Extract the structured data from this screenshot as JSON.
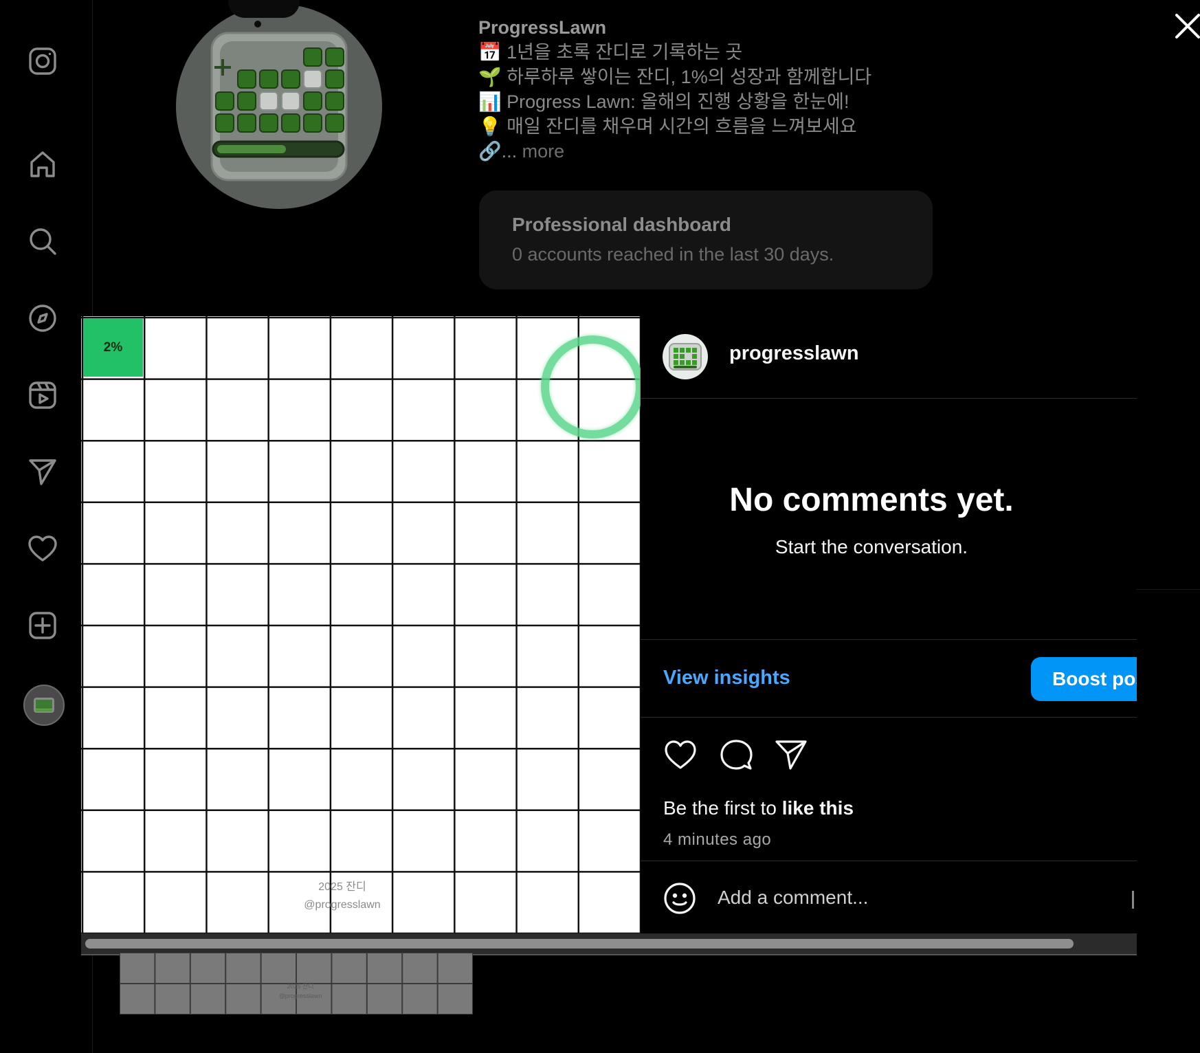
{
  "profile": {
    "username": "ProgressLawn",
    "bio_lines": [
      "📅 1년을 초록 잔디로 기록하는 곳",
      "🌱 하루하루 쌓이는 잔디, 1%의 성장과 함께합니다",
      "📊 Progress Lawn: 올해의 진행 상황을 한눈에!",
      "💡 매일 잔디를 채우며 시간의 흐름을 느껴보세요"
    ],
    "bio_more_prefix": "🔗...",
    "bio_more": "more",
    "dashboard_title": "Professional dashboard",
    "dashboard_subtitle": "0 accounts reached in the last 30 days."
  },
  "sidebar": {
    "items": [
      {
        "icon": "instagram-logo-icon"
      },
      {
        "icon": "home-icon"
      },
      {
        "icon": "search-icon"
      },
      {
        "icon": "explore-compass-icon"
      },
      {
        "icon": "reels-icon"
      },
      {
        "icon": "messages-send-icon"
      },
      {
        "icon": "notifications-heart-icon"
      },
      {
        "icon": "create-plus-icon"
      },
      {
        "icon": "profile-avatar"
      }
    ]
  },
  "post_image": {
    "progress_label": "2%",
    "filled_cells": 1,
    "grid_columns": 9,
    "grid_rows": 10,
    "fill_color": "#22c067",
    "watermark_line1": "2025 잔디",
    "watermark_line2": "@progresslawn"
  },
  "post_panel": {
    "username": "progresslawn",
    "empty_title": "No comments yet.",
    "empty_subtitle": "Start the conversation.",
    "view_insights": "View insights",
    "boost_button": "Boost post",
    "likes_prefix": "Be the first to ",
    "likes_bold": "like this",
    "timestamp": "4 minutes ago",
    "comment_placeholder": "Add a comment...",
    "accent_color": "#0095f6"
  },
  "thumbnail": {
    "watermark_line1": "2025 잔디",
    "watermark_line2": "@progresslawn"
  }
}
